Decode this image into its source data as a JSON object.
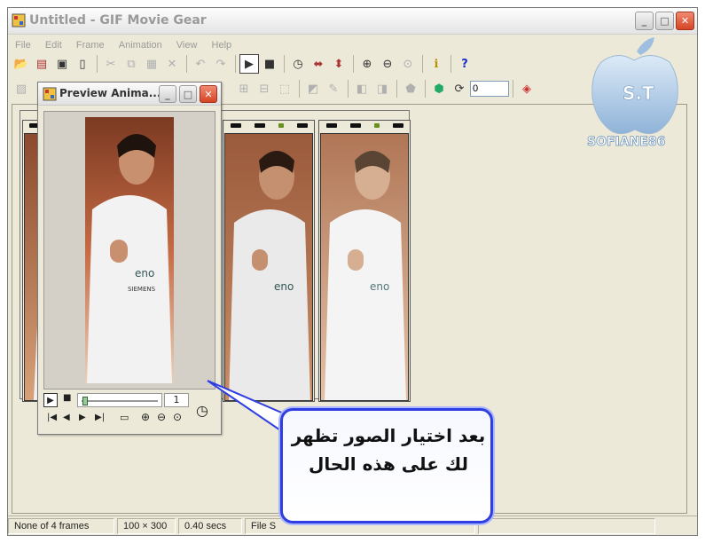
{
  "window": {
    "title": "Untitled - GIF Movie Gear"
  },
  "menu": [
    "File",
    "Edit",
    "Frame",
    "Animation",
    "View",
    "Help"
  ],
  "toolbar1": [
    "open-icon",
    "film-icon",
    "save-icon",
    "new-icon",
    "sep",
    "cut-icon",
    "copy-icon",
    "paste-icon",
    "delete-icon",
    "sep",
    "undo-icon",
    "redo-icon",
    "sep",
    "play-icon",
    "stop-icon",
    "sep",
    "timer-icon",
    "frames-icon",
    "frames-alt-icon",
    "sep",
    "zoom-in-icon",
    "zoom-out-icon",
    "zoom-fit-icon",
    "sep",
    "properties-icon",
    "sep",
    "help-icon"
  ],
  "toolbar2": {
    "value_field": "0"
  },
  "preview": {
    "title": "Preview Anima...",
    "frame_number": "1"
  },
  "status": {
    "frames": "None of 4 frames",
    "size": "100 × 300",
    "duration": "0.40 secs",
    "file": "File S"
  },
  "bubble": {
    "text": "بعد اختيار الصور تظهر لك على هذه الحال"
  },
  "logo": {
    "letters": "S.T",
    "name": "SOFIANE86"
  },
  "colors": {
    "bubble_border": "#2f3ee0",
    "close": "#d64524"
  }
}
